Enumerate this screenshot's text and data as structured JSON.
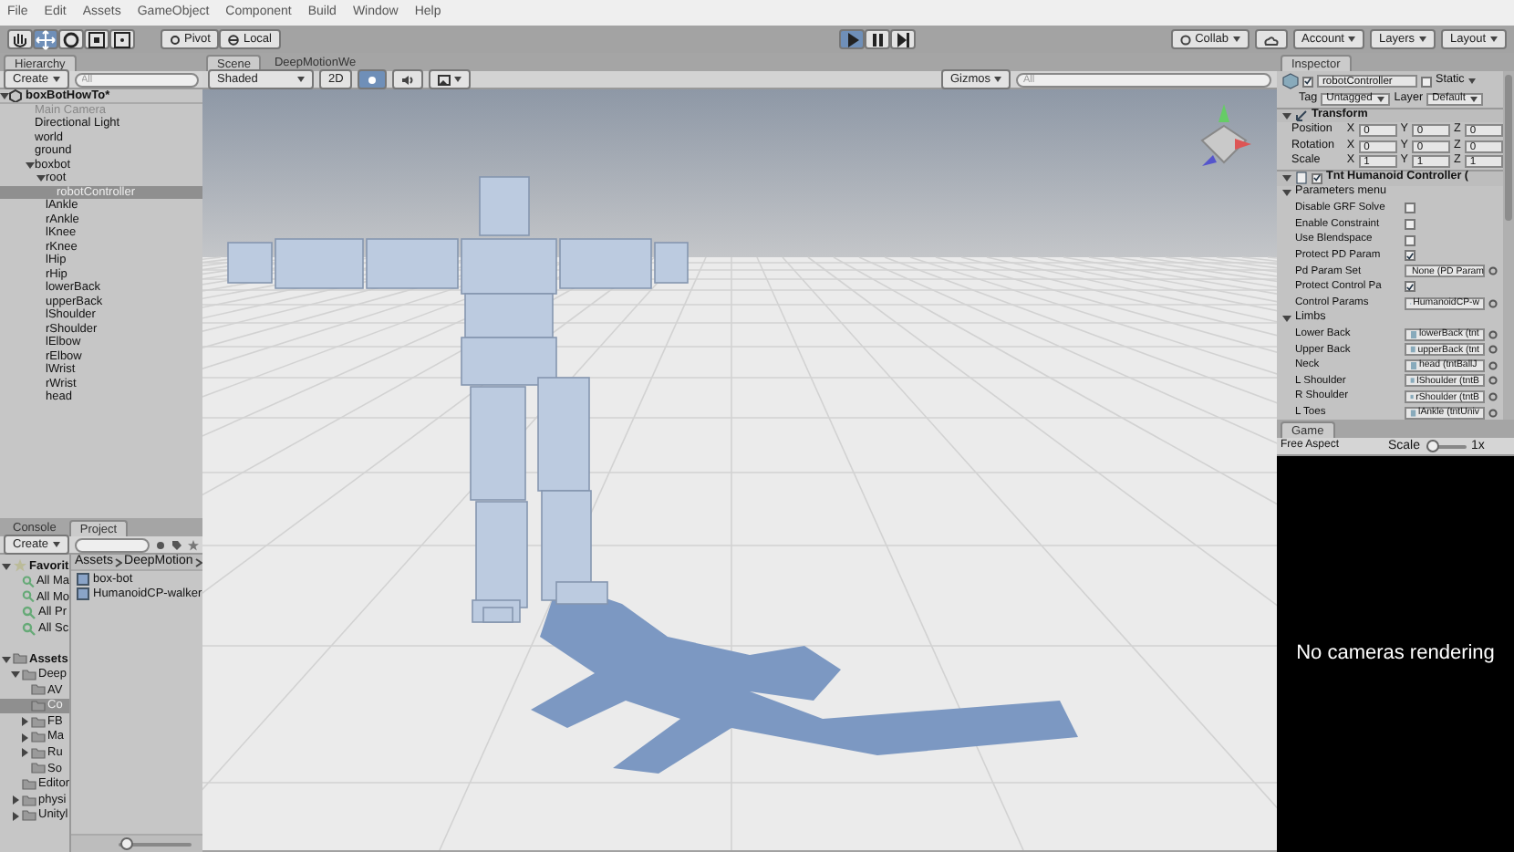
{
  "menu": [
    "File",
    "Edit",
    "Assets",
    "GameObject",
    "Component",
    "Build",
    "Window",
    "Help"
  ],
  "toolbar": {
    "tools": [
      {
        "kind": "hand",
        "selected": false
      },
      {
        "kind": "move",
        "selected": true
      },
      {
        "kind": "rotate",
        "selected": false
      },
      {
        "kind": "scale",
        "selected": false
      },
      {
        "kind": "rect",
        "selected": false
      }
    ],
    "pivot": "Pivot",
    "local": "Local",
    "playback": [
      {
        "kind": "play",
        "selected": true
      },
      {
        "kind": "pause",
        "selected": false
      },
      {
        "kind": "step",
        "selected": false
      }
    ],
    "collab": "Collab",
    "account": "Account",
    "layers": "Layers",
    "layout": "Layout"
  },
  "hierarchy": {
    "tab": "Hierarchy",
    "create": "Create",
    "search_placeholder": "All",
    "scene": "boxBotHowTo*",
    "items": [
      {
        "label": "Main Camera",
        "selected": false,
        "disabled": true
      },
      {
        "label": "Directional Light",
        "selected": false,
        "disabled": false
      },
      {
        "label": "world",
        "selected": false,
        "disabled": false
      },
      {
        "label": "ground",
        "selected": false,
        "disabled": false
      },
      {
        "label": "boxbot",
        "selected": false,
        "disabled": false,
        "expanded": true,
        "children": [
          {
            "label": "root",
            "selected": false,
            "disabled": false,
            "expanded": true,
            "children": [
              {
                "label": "robotController",
                "selected": true,
                "disabled": false
              }
            ]
          },
          {
            "label": "lAnkle",
            "selected": false,
            "disabled": false
          },
          {
            "label": "rAnkle",
            "selected": false,
            "disabled": false
          },
          {
            "label": "lKnee",
            "selected": false,
            "disabled": false
          },
          {
            "label": "rKnee",
            "selected": false,
            "disabled": false
          },
          {
            "label": "lHip",
            "selected": false,
            "disabled": false
          },
          {
            "label": "rHip",
            "selected": false,
            "disabled": false
          },
          {
            "label": "lowerBack",
            "selected": false,
            "disabled": false
          },
          {
            "label": "upperBack",
            "selected": false,
            "disabled": false
          },
          {
            "label": "lShoulder",
            "selected": false,
            "disabled": false
          },
          {
            "label": "rShoulder",
            "selected": false,
            "disabled": false
          },
          {
            "label": "lElbow",
            "selected": false,
            "disabled": false
          },
          {
            "label": "rElbow",
            "selected": false,
            "disabled": false
          },
          {
            "label": "lWrist",
            "selected": false,
            "disabled": false
          },
          {
            "label": "rWrist",
            "selected": false,
            "disabled": false
          },
          {
            "label": "head",
            "selected": false,
            "disabled": false
          }
        ]
      }
    ]
  },
  "project": {
    "tabs": [
      {
        "label": "Console",
        "selected": false
      },
      {
        "label": "Project",
        "selected": true
      }
    ],
    "create": "Create",
    "tree": [
      {
        "label": "Favorit",
        "kind": "favorites",
        "selected": false,
        "expanded": true,
        "children": [
          {
            "label": "All Ma",
            "kind": "search",
            "selected": false
          },
          {
            "label": "All Mo",
            "kind": "search",
            "selected": false
          },
          {
            "label": "All Pr",
            "kind": "search",
            "selected": false
          },
          {
            "label": "All Sc",
            "kind": "search",
            "selected": false
          }
        ]
      },
      {
        "label": "Assets",
        "kind": "folder",
        "selected": false,
        "expanded": true,
        "children": [
          {
            "label": "Deep",
            "kind": "folder",
            "selected": false,
            "expanded": true,
            "children": [
              {
                "label": "AV",
                "kind": "folder",
                "selected": false
              },
              {
                "label": "Co",
                "kind": "folder",
                "selected": true
              },
              {
                "label": "FB",
                "kind": "folder",
                "selected": false,
                "expanded": false
              },
              {
                "label": "Ma",
                "kind": "folder",
                "selected": false,
                "expanded": false
              },
              {
                "label": "Ru",
                "kind": "folder",
                "selected": false,
                "expanded": false
              },
              {
                "label": "So",
                "kind": "folder",
                "selected": false
              }
            ]
          },
          {
            "label": "Editor",
            "kind": "folder",
            "selected": false
          },
          {
            "label": "physi",
            "kind": "folder",
            "selected": false,
            "expanded": false
          },
          {
            "label": "Unityl",
            "kind": "folder",
            "selected": false,
            "expanded": false
          }
        ]
      }
    ],
    "breadcrumb": [
      "Assets",
      "DeepMotion"
    ],
    "files": [
      "box-bot",
      "HumanoidCP-walker"
    ],
    "zoom": {
      "level": 0.1
    }
  },
  "scene": {
    "tabs": [
      {
        "label": "Scene",
        "selected": true
      },
      {
        "label": "DeepMotionWe",
        "selected": false
      }
    ],
    "shading": "Shaded",
    "mode_2d": "2D",
    "lighting_on": true,
    "audio_on": false,
    "gizmos": "Gizmos",
    "search_placeholder": "All"
  },
  "inspector": {
    "tab": "Inspector",
    "object": {
      "active": true,
      "name": "robotController",
      "static": false,
      "static_label": "Static",
      "tag_label": "Tag",
      "tag": "Untagged",
      "layer_label": "Layer",
      "layer": "Default"
    },
    "components": [
      {
        "kind": "transform",
        "title": "Transform",
        "expanded": true,
        "rows": [
          {
            "label": "Position",
            "values": [
              {
                "axis": "X",
                "value": "0"
              },
              {
                "axis": "Y",
                "value": "0"
              },
              {
                "axis": "Z",
                "value": "0"
              }
            ]
          },
          {
            "label": "Rotation",
            "values": [
              {
                "axis": "X",
                "value": "0"
              },
              {
                "axis": "Y",
                "value": "0"
              },
              {
                "axis": "Z",
                "value": "0"
              }
            ]
          },
          {
            "label": "Scale",
            "values": [
              {
                "axis": "X",
                "value": "1"
              },
              {
                "axis": "Y",
                "value": "1"
              },
              {
                "axis": "Z",
                "value": "1"
              }
            ]
          }
        ]
      },
      {
        "kind": "script",
        "title": "Tnt Humanoid Controller (",
        "enabled": true,
        "expanded": true,
        "groups": [
          {
            "title": "Parameters menu",
            "expanded": true,
            "props": [
              {
                "kind": "checkbox",
                "label": "Disable GRF Solve",
                "checked": false
              },
              {
                "kind": "checkbox",
                "label": "Enable Constraint",
                "checked": false
              },
              {
                "kind": "checkbox",
                "label": "Use Blendspace",
                "checked": false
              },
              {
                "kind": "checkbox",
                "label": "Protect PD Param",
                "checked": true
              },
              {
                "kind": "object",
                "label": "Pd Param Set",
                "value": "None (PD Param"
              },
              {
                "kind": "checkbox",
                "label": "Protect Control Pa",
                "checked": true
              },
              {
                "kind": "object",
                "label": "Control Params",
                "value": "HumanoidCP-w"
              }
            ]
          },
          {
            "title": "Limbs",
            "expanded": true,
            "props": [
              {
                "kind": "object",
                "label": "Lower Back",
                "value": "lowerBack (tnt"
              },
              {
                "kind": "object",
                "label": "Upper Back",
                "value": "upperBack (tnt"
              },
              {
                "kind": "object",
                "label": "Neck",
                "value": "head (tntBallJ"
              },
              {
                "kind": "object",
                "label": "L Shoulder",
                "value": "lShoulder (tntB"
              },
              {
                "kind": "object",
                "label": "R Shoulder",
                "value": "rShoulder (tntB"
              },
              {
                "kind": "object",
                "label": "L Toes",
                "value": "lAnkle (tntUniv"
              }
            ]
          }
        ]
      }
    ]
  },
  "game": {
    "tab": "Game",
    "aspect": "Free Aspect",
    "scale_label": "Scale",
    "scale": "1x",
    "scale_slider": {
      "level": 0.15
    },
    "message": "No cameras rendering"
  }
}
